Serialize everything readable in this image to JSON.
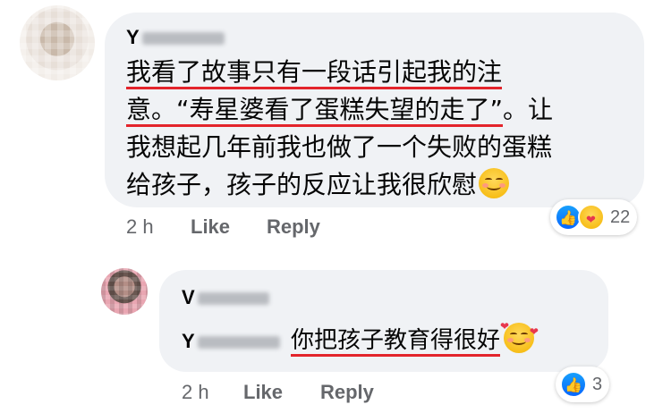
{
  "comments": [
    {
      "author": "Y",
      "lines": [
        {
          "underlined": "我看了故事只有一段话引起我的注",
          "rest": ""
        },
        {
          "underlined": "意。“寿星婆看了蛋糕失望的走了”",
          "rest": "。让"
        },
        {
          "underlined": "",
          "rest": "我想起几年前我也做了一个失败的蛋糕"
        },
        {
          "underlined": "",
          "rest": "给孩子，孩子的反应让我很欣慰"
        }
      ],
      "end_emoji": "smiling-face-icon",
      "time": "2 h",
      "like_label": "Like",
      "reply_label": "Reply",
      "reaction_icons": [
        "like-icon",
        "care-icon"
      ],
      "reaction_count": "22"
    },
    {
      "author": "V",
      "mention": "Y",
      "text": "你把孩子教育得很好",
      "end_emoji": "smiling-face-with-hearts-icon",
      "time": "2 h",
      "like_label": "Like",
      "reply_label": "Reply",
      "reaction_icons": [
        "like-icon"
      ],
      "reaction_count": "3"
    }
  ],
  "colors": {
    "bubble": "#f0f2f5",
    "underline": "#e3242b",
    "meta_text": "#65676b",
    "like_blue": "#0866ff"
  }
}
